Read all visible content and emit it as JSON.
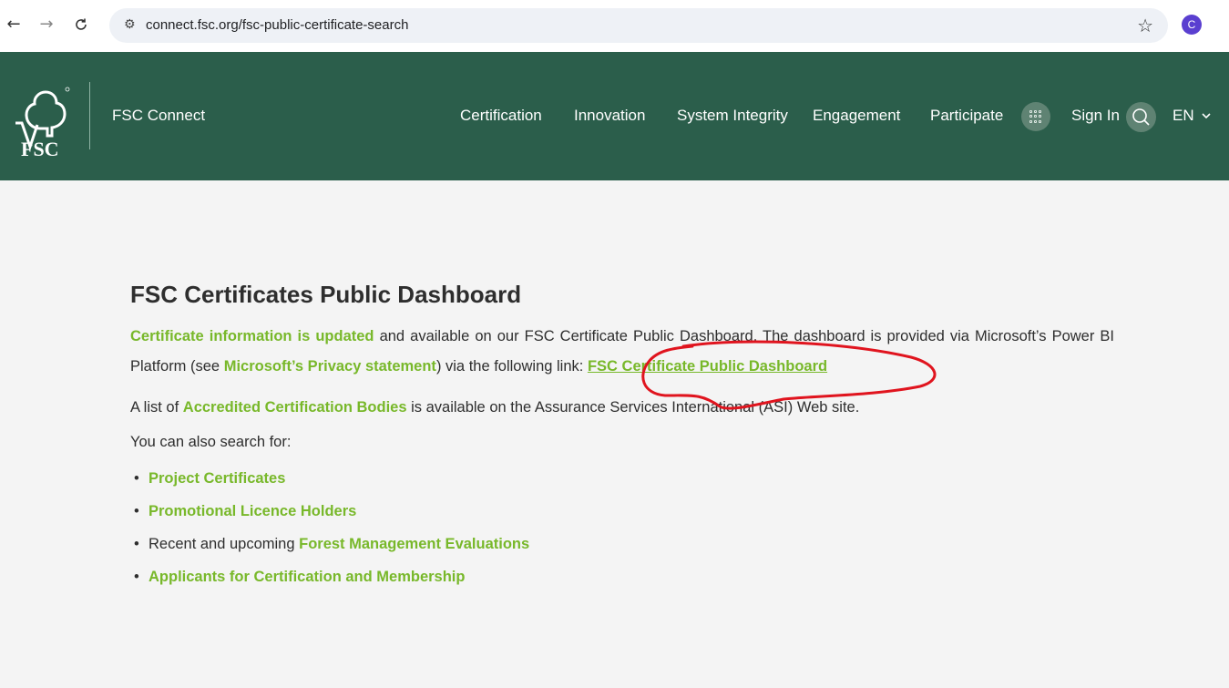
{
  "browser": {
    "back": "←",
    "forward": "→",
    "reload": "C",
    "url": "connect.fsc.org/fsc-public-certificate-search",
    "profile_initial": "C"
  },
  "header": {
    "logo_text": "FSC",
    "site_name": "FSC Connect",
    "nav": [
      "Certification",
      "Innovation",
      "System Integrity",
      "Engagement",
      "Participate"
    ],
    "sign_in": "Sign In",
    "language": "EN"
  },
  "main": {
    "title": "FSC Certificates Public Dashboard",
    "intro_link_1": "Certificate information is updated",
    "intro_text_1": " and available on our FSC Certificate Public Dashboard. The dashboard is provided via Microsoft’s Power BI Platform (see ",
    "intro_link_2": "Microsoft’s Privacy statement",
    "intro_text_2": ") via the following link: ",
    "intro_link_3": "FSC Certificate Public Dashboard",
    "accredited_prefix": "A list of ",
    "accredited_link": "Accredited Certification Bodies",
    "accredited_suffix": " is available on the Assurance Services International (ASI) Web site.",
    "also_search": "You can also search for:",
    "list": {
      "item1": "Project Certificates",
      "item2": "Promotional Licence Holders",
      "item3_prefix": "Recent and upcoming ",
      "item3_link": "Forest Management Evaluations",
      "item4": "Applicants for Certification and Membership"
    }
  },
  "colors": {
    "header_bg": "#2b5e4b",
    "link_green": "#78b82a",
    "annotation_red": "#e0141e"
  }
}
